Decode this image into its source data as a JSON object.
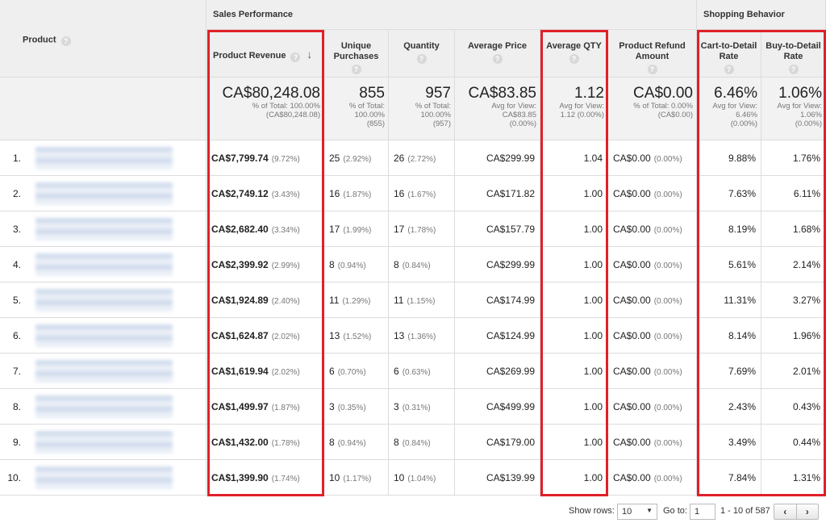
{
  "header": {
    "product": "Product",
    "sales_group": "Sales Performance",
    "shopping_group": "Shopping Behavior",
    "columns": [
      {
        "key": "revenue",
        "label": "Product Revenue"
      },
      {
        "key": "unique",
        "label": "Unique Purchases"
      },
      {
        "key": "quantity",
        "label": "Quantity"
      },
      {
        "key": "avg_price",
        "label": "Average Price"
      },
      {
        "key": "avg_qty",
        "label": "Average QTY"
      },
      {
        "key": "refund",
        "label": "Product Refund Amount"
      },
      {
        "key": "cart",
        "label": "Cart-to-Detail Rate"
      },
      {
        "key": "buy",
        "label": "Buy-to-Detail Rate"
      }
    ],
    "help_glyph": "?",
    "sort_glyph": "↓"
  },
  "totals": [
    {
      "big": "CA$80,248.08",
      "l1": "% of Total: 100.00%",
      "l2": "(CA$80,248.08)",
      "l3": ""
    },
    {
      "big": "855",
      "l1": "% of Total:",
      "l2": "100.00%",
      "l3": "(855)"
    },
    {
      "big": "957",
      "l1": "% of Total:",
      "l2": "100.00%",
      "l3": "(957)"
    },
    {
      "big": "CA$83.85",
      "l1": "Avg for View:",
      "l2": "CA$83.85",
      "l3": "(0.00%)"
    },
    {
      "big": "1.12",
      "l1": "Avg for View:",
      "l2": "1.12 (0.00%)",
      "l3": ""
    },
    {
      "big": "CA$0.00",
      "l1": "% of Total: 0.00%",
      "l2": "(CA$0.00)",
      "l3": ""
    },
    {
      "big": "6.46%",
      "l1": "Avg for View:",
      "l2": "6.46%",
      "l3": "(0.00%)"
    },
    {
      "big": "1.06%",
      "l1": "Avg for View:",
      "l2": "1.06%",
      "l3": "(0.00%)"
    }
  ],
  "rows": [
    {
      "idx": "1.",
      "revenue": "CA$7,799.74",
      "revenue_pct": "(9.72%)",
      "unique": "25",
      "unique_pct": "(2.92%)",
      "quantity": "26",
      "quantity_pct": "(2.72%)",
      "avg_price": "CA$299.99",
      "avg_qty": "1.04",
      "refund": "CA$0.00",
      "refund_pct": "(0.00%)",
      "cart": "9.88%",
      "buy": "1.76%"
    },
    {
      "idx": "2.",
      "revenue": "CA$2,749.12",
      "revenue_pct": "(3.43%)",
      "unique": "16",
      "unique_pct": "(1.87%)",
      "quantity": "16",
      "quantity_pct": "(1.67%)",
      "avg_price": "CA$171.82",
      "avg_qty": "1.00",
      "refund": "CA$0.00",
      "refund_pct": "(0.00%)",
      "cart": "7.63%",
      "buy": "6.11%"
    },
    {
      "idx": "3.",
      "revenue": "CA$2,682.40",
      "revenue_pct": "(3.34%)",
      "unique": "17",
      "unique_pct": "(1.99%)",
      "quantity": "17",
      "quantity_pct": "(1.78%)",
      "avg_price": "CA$157.79",
      "avg_qty": "1.00",
      "refund": "CA$0.00",
      "refund_pct": "(0.00%)",
      "cart": "8.19%",
      "buy": "1.68%"
    },
    {
      "idx": "4.",
      "revenue": "CA$2,399.92",
      "revenue_pct": "(2.99%)",
      "unique": "8",
      "unique_pct": "(0.94%)",
      "quantity": "8",
      "quantity_pct": "(0.84%)",
      "avg_price": "CA$299.99",
      "avg_qty": "1.00",
      "refund": "CA$0.00",
      "refund_pct": "(0.00%)",
      "cart": "5.61%",
      "buy": "2.14%"
    },
    {
      "idx": "5.",
      "revenue": "CA$1,924.89",
      "revenue_pct": "(2.40%)",
      "unique": "11",
      "unique_pct": "(1.29%)",
      "quantity": "11",
      "quantity_pct": "(1.15%)",
      "avg_price": "CA$174.99",
      "avg_qty": "1.00",
      "refund": "CA$0.00",
      "refund_pct": "(0.00%)",
      "cart": "11.31%",
      "buy": "3.27%"
    },
    {
      "idx": "6.",
      "revenue": "CA$1,624.87",
      "revenue_pct": "(2.02%)",
      "unique": "13",
      "unique_pct": "(1.52%)",
      "quantity": "13",
      "quantity_pct": "(1.36%)",
      "avg_price": "CA$124.99",
      "avg_qty": "1.00",
      "refund": "CA$0.00",
      "refund_pct": "(0.00%)",
      "cart": "8.14%",
      "buy": "1.96%"
    },
    {
      "idx": "7.",
      "revenue": "CA$1,619.94",
      "revenue_pct": "(2.02%)",
      "unique": "6",
      "unique_pct": "(0.70%)",
      "quantity": "6",
      "quantity_pct": "(0.63%)",
      "avg_price": "CA$269.99",
      "avg_qty": "1.00",
      "refund": "CA$0.00",
      "refund_pct": "(0.00%)",
      "cart": "7.69%",
      "buy": "2.01%"
    },
    {
      "idx": "8.",
      "revenue": "CA$1,499.97",
      "revenue_pct": "(1.87%)",
      "unique": "3",
      "unique_pct": "(0.35%)",
      "quantity": "3",
      "quantity_pct": "(0.31%)",
      "avg_price": "CA$499.99",
      "avg_qty": "1.00",
      "refund": "CA$0.00",
      "refund_pct": "(0.00%)",
      "cart": "2.43%",
      "buy": "0.43%"
    },
    {
      "idx": "9.",
      "revenue": "CA$1,432.00",
      "revenue_pct": "(1.78%)",
      "unique": "8",
      "unique_pct": "(0.94%)",
      "quantity": "8",
      "quantity_pct": "(0.84%)",
      "avg_price": "CA$179.00",
      "avg_qty": "1.00",
      "refund": "CA$0.00",
      "refund_pct": "(0.00%)",
      "cart": "3.49%",
      "buy": "0.44%"
    },
    {
      "idx": "10.",
      "revenue": "CA$1,399.90",
      "revenue_pct": "(1.74%)",
      "unique": "10",
      "unique_pct": "(1.17%)",
      "quantity": "10",
      "quantity_pct": "(1.04%)",
      "avg_price": "CA$139.99",
      "avg_qty": "1.00",
      "refund": "CA$0.00",
      "refund_pct": "(0.00%)",
      "cart": "7.84%",
      "buy": "1.31%"
    }
  ],
  "footer": {
    "show_rows_label": "Show rows:",
    "show_rows_value": "10",
    "goto_label": "Go to:",
    "goto_value": "1",
    "range": "1 - 10 of 587",
    "prev": "‹",
    "next": "›"
  },
  "highlight_color": "#e0202a"
}
